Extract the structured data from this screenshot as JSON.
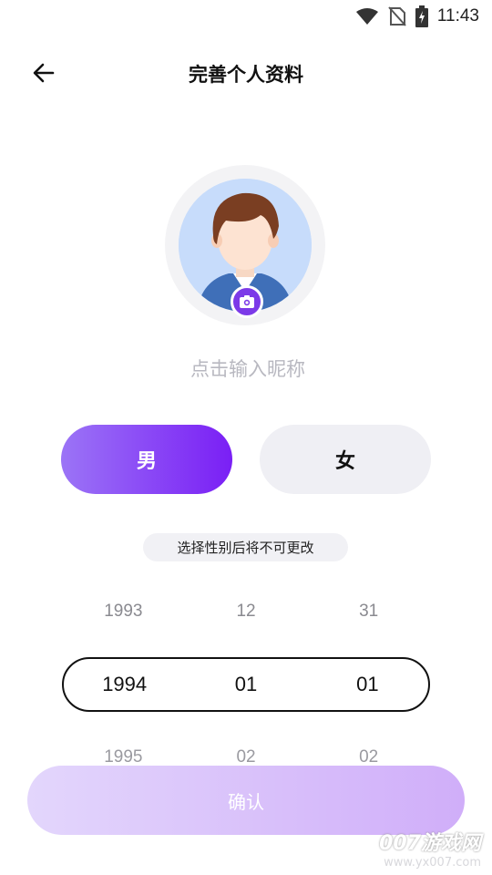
{
  "status_bar": {
    "time": "11:43",
    "icons": [
      "wifi-icon",
      "no-sim-icon",
      "battery-charging-icon"
    ]
  },
  "header": {
    "back_icon": "arrow-left-icon",
    "title": "完善个人资料"
  },
  "avatar": {
    "camera_icon": "camera-icon"
  },
  "nickname": {
    "placeholder": "点击输入昵称"
  },
  "gender": {
    "male": "男",
    "female": "女",
    "selected": "男"
  },
  "hint": "选择性别后将不可更改",
  "date_picker": {
    "prev": {
      "year": "1993",
      "month": "12",
      "day": "31"
    },
    "selected": {
      "year": "1994",
      "month": "01",
      "day": "01"
    },
    "next": {
      "year": "1995",
      "month": "02",
      "day": "02"
    }
  },
  "confirm_label": "确认",
  "watermark": {
    "main": "007游戏网",
    "sub": "www.yx007.com"
  },
  "colors": {
    "accent_start": "#9b74f6",
    "accent_end": "#7a1ff5",
    "confirm_start": "#e3d6fc",
    "confirm_end": "#d0aef9"
  }
}
